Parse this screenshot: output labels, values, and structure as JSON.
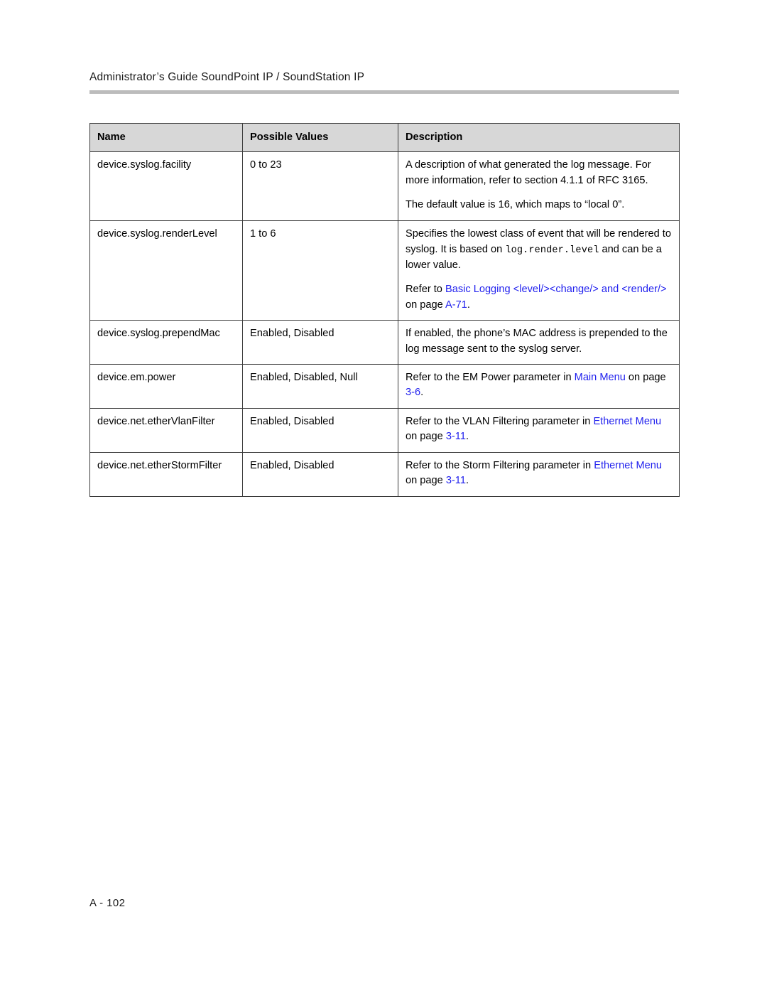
{
  "document": {
    "running_header": "Administrator’s Guide SoundPoint IP / SoundStation IP",
    "footer_page": "A - 102"
  },
  "table": {
    "headers": {
      "name": "Name",
      "possible_values": "Possible Values",
      "description": "Description"
    },
    "rows": [
      {
        "name": "device.syslog.facility",
        "possible_values": "0 to 23",
        "description_paragraphs": [
          {
            "runs": [
              {
                "text": "A description of what generated the log message. For more information, refer to section 4.1.1 of RFC 3165.",
                "style": "plain"
              }
            ]
          },
          {
            "runs": [
              {
                "text": "The default value is 16, which maps to “local 0”.",
                "style": "plain"
              }
            ]
          }
        ]
      },
      {
        "name": "device.syslog.renderLevel",
        "possible_values": "1 to 6",
        "description_paragraphs": [
          {
            "runs": [
              {
                "text": "Specifies the lowest class of event that will be rendered to syslog. It is based on ",
                "style": "plain"
              },
              {
                "text": "log.render.level",
                "style": "mono"
              },
              {
                "text": " and can be a lower value.",
                "style": "plain"
              }
            ]
          },
          {
            "runs": [
              {
                "text": "Refer to ",
                "style": "plain"
              },
              {
                "text": "Basic Logging <level/><change/> and <render/>",
                "style": "link"
              },
              {
                "text": " on page ",
                "style": "plain"
              },
              {
                "text": "A-71",
                "style": "link"
              },
              {
                "text": ".",
                "style": "plain"
              }
            ]
          }
        ]
      },
      {
        "name": "device.syslog.prependMac",
        "possible_values": "Enabled, Disabled",
        "description_paragraphs": [
          {
            "runs": [
              {
                "text": "If enabled, the phone’s MAC address is prepended to the log message sent to the syslog server.",
                "style": "plain"
              }
            ]
          }
        ]
      },
      {
        "name": "device.em.power",
        "possible_values": "Enabled, Disabled, Null",
        "description_paragraphs": [
          {
            "runs": [
              {
                "text": "Refer to the EM Power parameter in ",
                "style": "plain"
              },
              {
                "text": "Main Menu",
                "style": "link"
              },
              {
                "text": " on page ",
                "style": "plain"
              },
              {
                "text": "3-6",
                "style": "link"
              },
              {
                "text": ".",
                "style": "plain"
              }
            ]
          }
        ]
      },
      {
        "name": "device.net.etherVlanFilter",
        "possible_values": "Enabled, Disabled",
        "description_paragraphs": [
          {
            "runs": [
              {
                "text": "Refer to the VLAN Filtering parameter in ",
                "style": "plain"
              },
              {
                "text": "Ethernet Menu",
                "style": "link"
              },
              {
                "text": " on page ",
                "style": "plain"
              },
              {
                "text": "3-11",
                "style": "link"
              },
              {
                "text": ".",
                "style": "plain"
              }
            ]
          }
        ]
      },
      {
        "name": "device.net.etherStormFilter",
        "possible_values": "Enabled, Disabled",
        "description_paragraphs": [
          {
            "runs": [
              {
                "text": "Refer to the Storm Filtering parameter in ",
                "style": "plain"
              },
              {
                "text": "Ethernet Menu",
                "style": "link"
              },
              {
                "text": " on page ",
                "style": "plain"
              },
              {
                "text": "3-11",
                "style": "link"
              },
              {
                "text": ".",
                "style": "plain"
              }
            ]
          }
        ]
      }
    ]
  },
  "colors": {
    "link": "#2222ee",
    "header_row_background": "#d7d7d7",
    "header_rule": "#bcbcbc",
    "table_border": "#3a3a3a",
    "text": "#000000"
  }
}
